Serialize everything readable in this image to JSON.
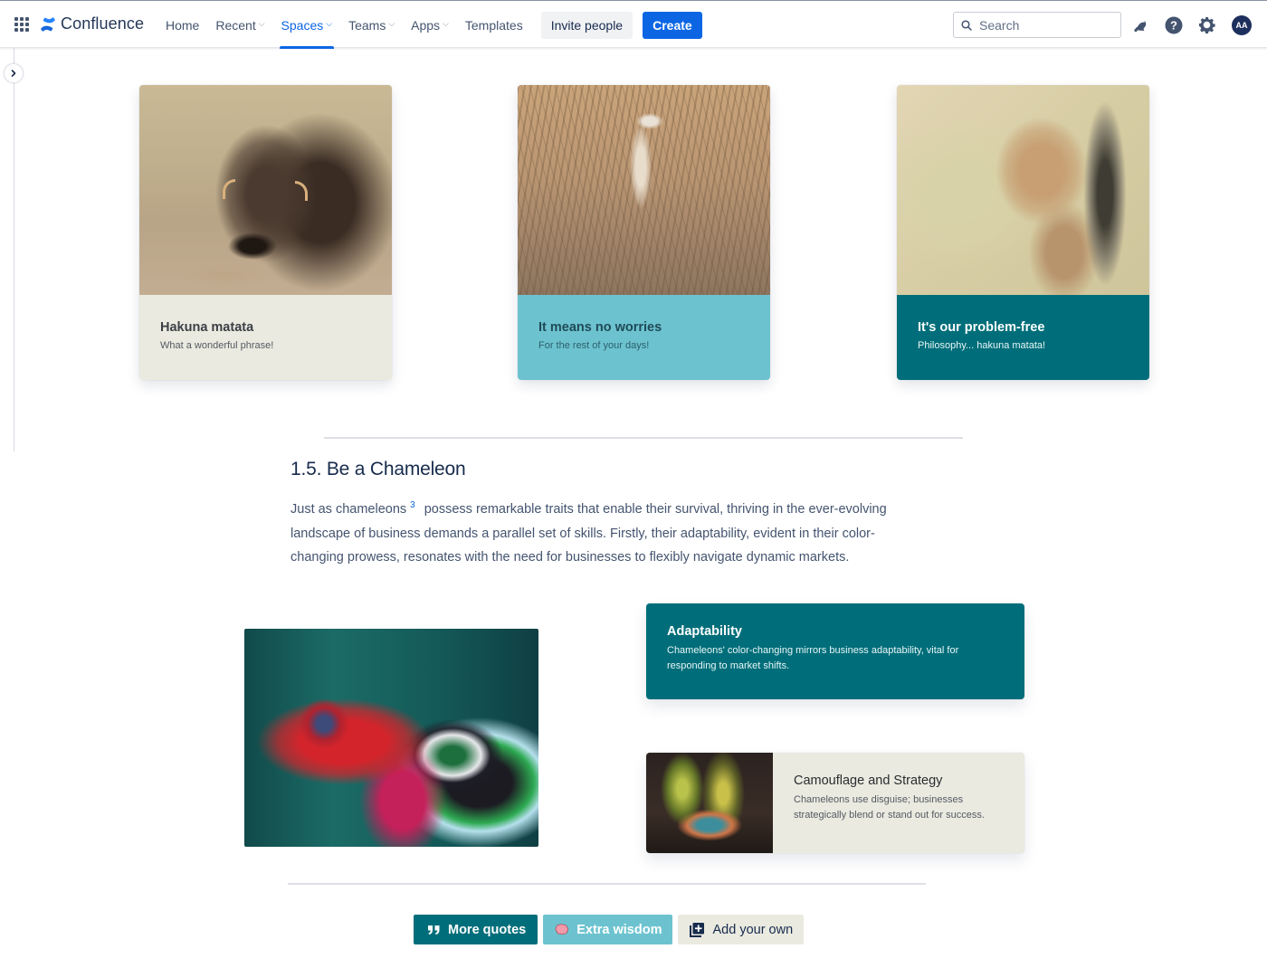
{
  "app": {
    "name": "Confluence",
    "brand_color": "#0c66e4"
  },
  "nav": {
    "items": [
      {
        "label": "Home",
        "has_dropdown": false,
        "active": false
      },
      {
        "label": "Recent",
        "has_dropdown": true,
        "active": false
      },
      {
        "label": "Spaces",
        "has_dropdown": true,
        "active": true
      },
      {
        "label": "Teams",
        "has_dropdown": true,
        "active": false
      },
      {
        "label": "Apps",
        "has_dropdown": true,
        "active": false
      },
      {
        "label": "Templates",
        "has_dropdown": false,
        "active": false
      }
    ],
    "invite_label": "Invite people",
    "create_label": "Create"
  },
  "search": {
    "placeholder": "Search",
    "value": ""
  },
  "header_icons": [
    "notifications-icon",
    "help-icon",
    "settings-icon"
  ],
  "user": {
    "initials": "AA"
  },
  "cards": [
    {
      "title": "Hakuna matata",
      "subtitle": "What a wonderful phrase!",
      "image": "warthog",
      "color": "#eaeae0"
    },
    {
      "title": "It means no worries",
      "subtitle": "For the rest of your days!",
      "image": "meerkat",
      "color": "#6cc3cf"
    },
    {
      "title": "It's our problem-free",
      "subtitle": "Philosophy... hakuna matata!",
      "image": "lion cub",
      "color": "#006e7a"
    }
  ],
  "section": {
    "heading": "1.5. Be a Chameleon",
    "para_start": "Just as chameleons",
    "footnote": "3",
    "para_rest": "possess remarkable traits that enable their survival, thriving in the ever-evolving landscape of business demands a parallel set of skills. Firstly, their adaptability, evident in their color-changing prowess, resonates with the need for businesses to flexibly navigate dynamic markets."
  },
  "features": [
    {
      "title": "Adaptability",
      "text": "Chameleons' color-changing mirrors business adaptability, vital for responding to market shifts.",
      "color": "#006e7a"
    },
    {
      "title": "Camouflage and Strategy",
      "text": "Chameleons use disguise; businesses strategically blend or stand out for success.",
      "color": "#eaeae0"
    }
  ],
  "buttons": {
    "more_quotes": "More quotes",
    "extra_wisdom": "Extra wisdom",
    "add_your_own": "Add your own"
  }
}
